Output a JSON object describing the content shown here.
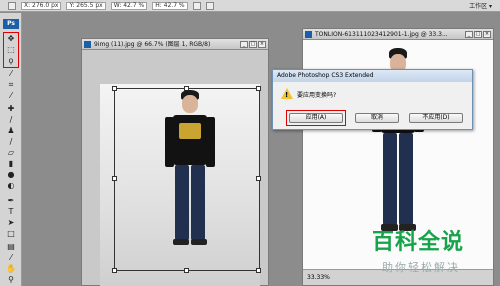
{
  "options_bar": {
    "field_values": [
      "X: 276.0 px",
      "Y: 265.5 px",
      "W: 42.7 %",
      "H: 42.7 %"
    ],
    "workspace_label": "工作区 ▾"
  },
  "tools": {
    "logo": "Ps",
    "icons": [
      "move-icon",
      "marquee-icon",
      "lasso-icon",
      "magic-wand-icon",
      "crop-icon",
      "eyedropper-icon",
      "healing-icon",
      "brush-icon",
      "clone-stamp-icon",
      "history-brush-icon",
      "eraser-icon",
      "gradient-icon",
      "blur-icon",
      "dodge-icon",
      "pen-icon",
      "type-icon",
      "path-select-icon",
      "shape-icon",
      "notes-icon",
      "hand-icon",
      "zoom-icon"
    ]
  },
  "doc1": {
    "title": "9img (11).jpg @ 66.7% (图层 1, RGB/8)"
  },
  "doc2": {
    "title": "TONLION-613111023412901-1.jpg @ 33.3...",
    "zoom": "33.33%"
  },
  "dialog": {
    "title": "Adobe Photoshop CS3 Extended",
    "message": "要应用变换吗?",
    "apply_label": "应用(A)",
    "cancel_label": "取消",
    "dont_apply_label": "不应用(D)"
  },
  "watermark": {
    "title": "百科全说",
    "subtitle": "助你轻松解决"
  },
  "colors": {
    "highlight": "#e00000",
    "watermark_green": "#16a34a",
    "ps_blue": "#1b5fa8"
  }
}
